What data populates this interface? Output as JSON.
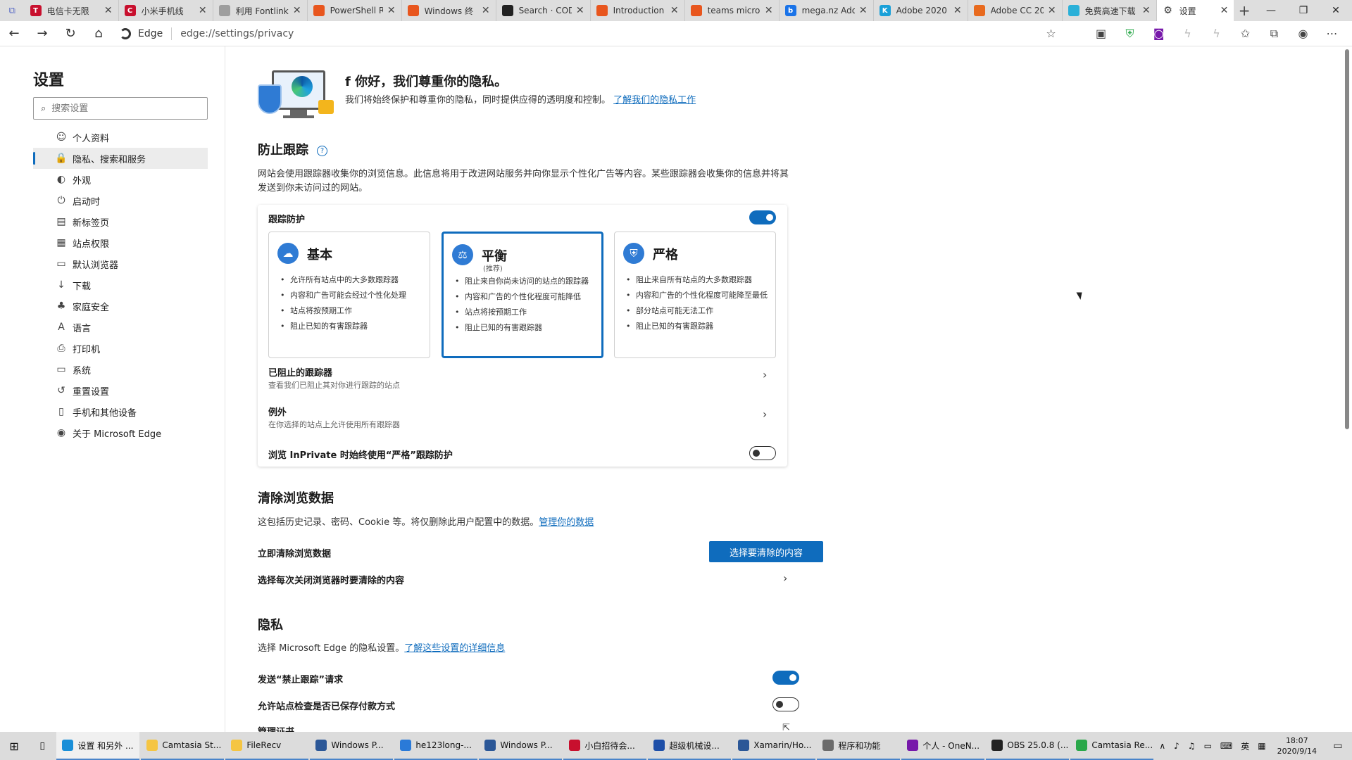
{
  "browser": {
    "tabs": [
      {
        "label": "电信卡无限",
        "color": "#c8102e",
        "glyph": "T"
      },
      {
        "label": "小米手机线",
        "color": "#c8102e",
        "glyph": "C"
      },
      {
        "label": "利用 Fontlink",
        "color": "#9e9e9e",
        "glyph": ""
      },
      {
        "label": "PowerShell R",
        "color": "#e8561e",
        "glyph": ""
      },
      {
        "label": "Windows 终",
        "color": "#e8561e",
        "glyph": ""
      },
      {
        "label": "Search · COD",
        "color": "#222222",
        "glyph": ""
      },
      {
        "label": "Introduction",
        "color": "#e8561e",
        "glyph": ""
      },
      {
        "label": "teams micro",
        "color": "#e8561e",
        "glyph": ""
      },
      {
        "label": "mega.nz Ado",
        "color": "#1a73e8",
        "glyph": "b"
      },
      {
        "label": "Adobe 2020",
        "color": "#1aa0d8",
        "glyph": "K"
      },
      {
        "label": "Adobe CC 20",
        "color": "#e86a1e",
        "glyph": ""
      },
      {
        "label": "免费高速下载",
        "color": "#2ab0d8",
        "glyph": ""
      }
    ],
    "active_tab": "设置",
    "address": {
      "brand": "Edge",
      "url": "edge://settings/privacy"
    }
  },
  "sidebar": {
    "title": "设置",
    "search_placeholder": "搜索设置",
    "items": [
      {
        "label": "个人资料",
        "icon": "profile-icon",
        "glyph": "☺"
      },
      {
        "label": "隐私、搜索和服务",
        "icon": "lock-icon",
        "glyph": "🔒"
      },
      {
        "label": "外观",
        "icon": "palette-icon",
        "glyph": "◐"
      },
      {
        "label": "启动时",
        "icon": "power-icon",
        "glyph": "⏻"
      },
      {
        "label": "新标签页",
        "icon": "newtab-icon",
        "glyph": "▤"
      },
      {
        "label": "站点权限",
        "icon": "site-permissions-icon",
        "glyph": "▦"
      },
      {
        "label": "默认浏览器",
        "icon": "browser-icon",
        "glyph": "▭"
      },
      {
        "label": "下载",
        "icon": "download-icon",
        "glyph": "↓"
      },
      {
        "label": "家庭安全",
        "icon": "family-icon",
        "glyph": "♣"
      },
      {
        "label": "语言",
        "icon": "language-icon",
        "glyph": "A"
      },
      {
        "label": "打印机",
        "icon": "printer-icon",
        "glyph": "⎙"
      },
      {
        "label": "系统",
        "icon": "system-icon",
        "glyph": "▭"
      },
      {
        "label": "重置设置",
        "icon": "reset-icon",
        "glyph": "↺"
      },
      {
        "label": "手机和其他设备",
        "icon": "phone-icon",
        "glyph": "▯"
      },
      {
        "label": "关于 Microsoft Edge",
        "icon": "edge-icon",
        "glyph": "◉"
      }
    ],
    "active_index": 1
  },
  "hero": {
    "title": "f 你好，我们尊重你的隐私。",
    "desc": "我们将始终保护和尊重你的隐私，同时提供应得的透明度和控制。",
    "link": "了解我们的隐私工作"
  },
  "tracking": {
    "title": "防止跟踪",
    "desc": "网站会使用跟踪器收集你的浏览信息。此信息将用于改进网站服务并向你显示个性化广告等内容。某些跟踪器会收集你的信息并将其发送到你未访问过的网站。",
    "card_title": "跟踪防护",
    "levels": [
      {
        "name": "基本",
        "sub": "",
        "bullets": [
          "允许所有站点中的大多数跟踪器",
          "内容和广告可能会经过个性化处理",
          "站点将按预期工作",
          "阻止已知的有害跟踪器"
        ]
      },
      {
        "name": "平衡",
        "sub": "(推荐)",
        "bullets": [
          "阻止来自你尚未访问的站点的跟踪器",
          "内容和广告的个性化程度可能降低",
          "站点将按预期工作",
          "阻止已知的有害跟踪器"
        ]
      },
      {
        "name": "严格",
        "sub": "",
        "bullets": [
          "阻止来自所有站点的大多数跟踪器",
          "内容和广告的个性化程度可能降至最低",
          "部分站点可能无法工作",
          "阻止已知的有害跟踪器"
        ]
      }
    ],
    "selected_level": 1,
    "blocked_title": "已阻止的跟踪器",
    "blocked_sub": "查看我们已阻止其对你进行跟踪的站点",
    "exceptions_title": "例外",
    "exceptions_sub": "在你选择的站点上允许使用所有跟踪器",
    "inprivate_label": "浏览 InPrivate 时始终使用“严格”跟踪防护"
  },
  "clear": {
    "title": "清除浏览数据",
    "desc": "这包括历史记录、密码、Cookie 等。将仅删除此用户配置中的数据。",
    "link": "管理你的数据",
    "now_label": "立即清除浏览数据",
    "button": "选择要清除的内容",
    "on_close_label": "选择每次关闭浏览器时要清除的内容"
  },
  "privacy": {
    "title": "隐私",
    "desc": "选择 Microsoft Edge 的隐私设置。",
    "link": "了解这些设置的详细信息",
    "dnt_label": "发送“禁止跟踪”请求",
    "payment_label": "允许站点检查是否已保存付款方式",
    "cert_label": "管理证书"
  },
  "taskbar": {
    "apps": [
      {
        "label": "设置 和另外 ...",
        "color": "#1a8fd8"
      },
      {
        "label": "Camtasia St...",
        "color": "#f5c542"
      },
      {
        "label": "FileRecv",
        "color": "#f5c542"
      },
      {
        "label": "Windows P...",
        "color": "#2b5797"
      },
      {
        "label": "he123long-...",
        "color": "#2a7ad8"
      },
      {
        "label": "Windows P...",
        "color": "#2b5797"
      },
      {
        "label": "小白招待会...",
        "color": "#c8102e"
      },
      {
        "label": "超级机械设...",
        "color": "#1e4fa8"
      },
      {
        "label": "Xamarin/Ho...",
        "color": "#2b5797"
      },
      {
        "label": "程序和功能",
        "color": "#6b6b6b"
      },
      {
        "label": "个人 - OneN...",
        "color": "#7719aa"
      },
      {
        "label": "OBS 25.0.8 (...",
        "color": "#222222"
      },
      {
        "label": "Camtasia Re...",
        "color": "#2aa84a"
      }
    ],
    "ime": "英",
    "time": "18:07",
    "date": "2020/9/14"
  }
}
